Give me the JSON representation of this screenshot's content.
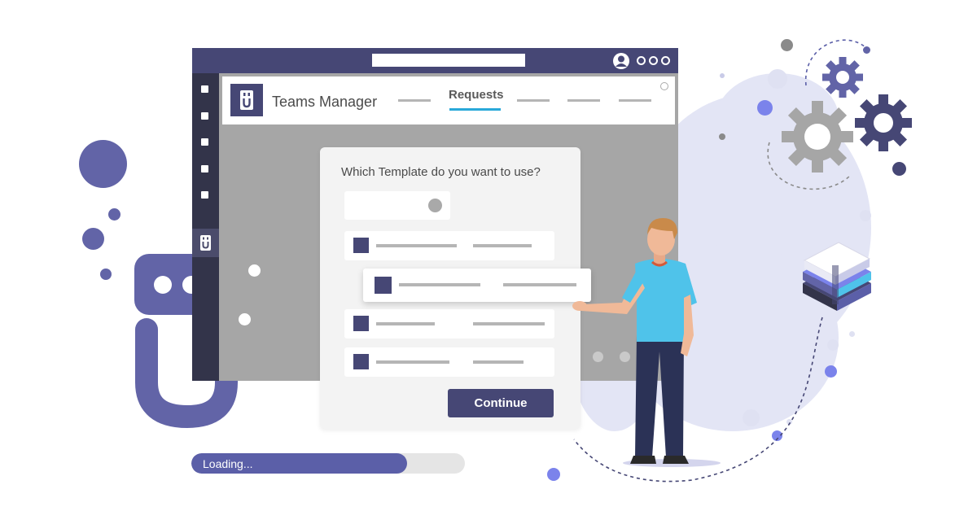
{
  "app": {
    "name": "Teams Manager",
    "active_tab": "Requests"
  },
  "dialog": {
    "title": "Which Template do you want to use?",
    "continue_label": "Continue"
  },
  "loading": {
    "label": "Loading...",
    "progress": 0.79
  },
  "colors": {
    "brand_purple": "#464775",
    "accent_purple": "#6264a7",
    "tab_underline": "#29a8d9",
    "shirt_blue": "#4fc3ea"
  },
  "icons": {
    "profile": "person-icon",
    "rail_app": "teams-manager-app-icon",
    "gears": "gear-icon",
    "books": "book-stack-icon",
    "badge": "star-badge-icon"
  }
}
